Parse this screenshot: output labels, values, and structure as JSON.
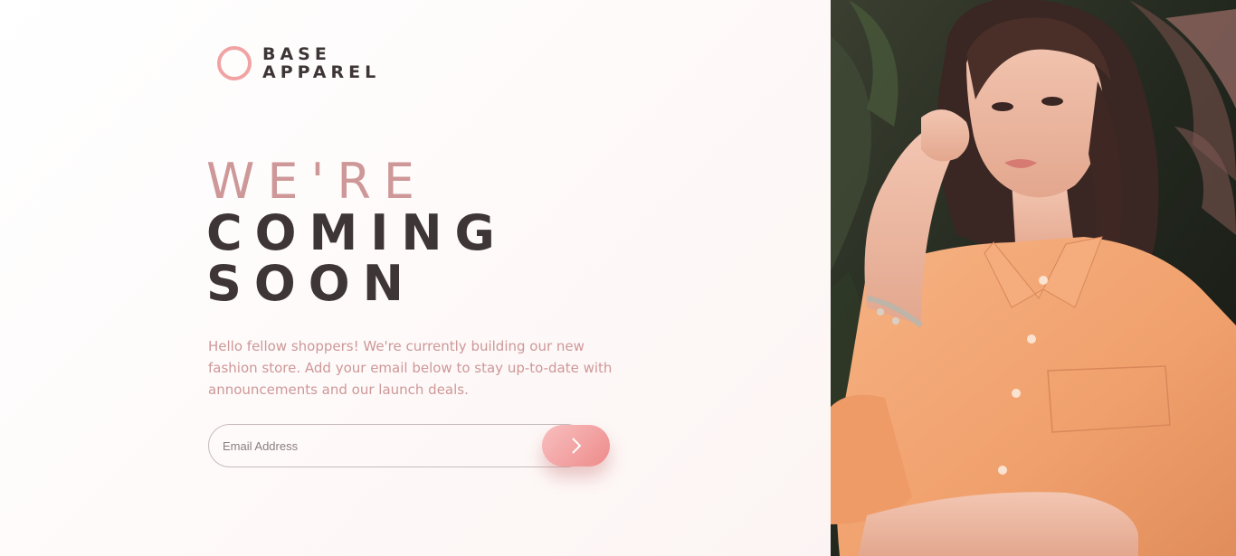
{
  "brand": {
    "line1": "BASE",
    "line2": "APPAREL",
    "accent_color": "#f1a3a4",
    "text_color": "#3d3536"
  },
  "hero": {
    "light": "WE'RE",
    "bold_line1": "COMING",
    "bold_line2": "SOON",
    "description": "Hello fellow shoppers! We're currently building our new fashion store. Add your email below to stay up-to-date with announcements and our launch deals."
  },
  "form": {
    "email_placeholder": "Email Address",
    "email_value": "",
    "submit_icon": "chevron-right-icon"
  },
  "hero_image": {
    "icon": "woman-in-peach-shirt-photo"
  },
  "colors": {
    "desaturated_red": "#ce9798",
    "dark_grayish_red": "#3d3536",
    "button_gradient_start": "#f8bfbf",
    "button_gradient_end": "#ee8b8b",
    "shirt": "#f3a676"
  }
}
